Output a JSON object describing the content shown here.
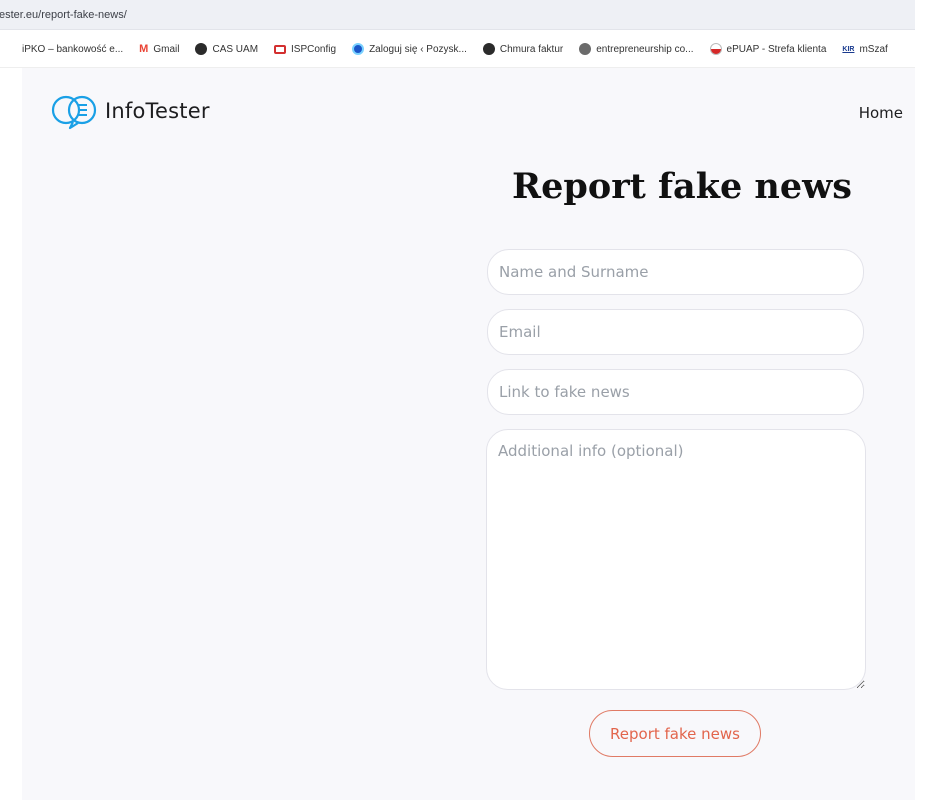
{
  "browser": {
    "url": "ester.eu/report-fake-news/",
    "bookmarks": [
      {
        "label": "iPKO – bankowość e...",
        "icon": "none"
      },
      {
        "label": "Gmail",
        "icon": "gmail-icon"
      },
      {
        "label": "CAS UAM",
        "icon": "globe-icon"
      },
      {
        "label": "ISPConfig",
        "icon": "monitor-icon"
      },
      {
        "label": "Zaloguj się ‹ Pozysk...",
        "icon": "blue-circle-icon"
      },
      {
        "label": "Chmura faktur",
        "icon": "globe-icon"
      },
      {
        "label": "entrepreneurship co...",
        "icon": "fox-icon"
      },
      {
        "label": "ePUAP - Strefa klienta",
        "icon": "flag-icon"
      },
      {
        "label": "mSzaf",
        "icon": "kir-icon"
      }
    ],
    "gmail_glyph": "M",
    "kir_glyph": "KIR"
  },
  "header": {
    "logo_text": "InfoTester",
    "nav_home": "Home"
  },
  "main": {
    "title": "Report fake news",
    "fields": {
      "name_placeholder": "Name and Surname",
      "email_placeholder": "Email",
      "link_placeholder": "Link to fake news",
      "info_placeholder": "Additional info (optional)"
    },
    "submit_label": "Report fake news"
  },
  "colors": {
    "accent": "#e2654c",
    "logo_blue": "#1aa0e6",
    "page_bg": "#f8f8fb"
  }
}
